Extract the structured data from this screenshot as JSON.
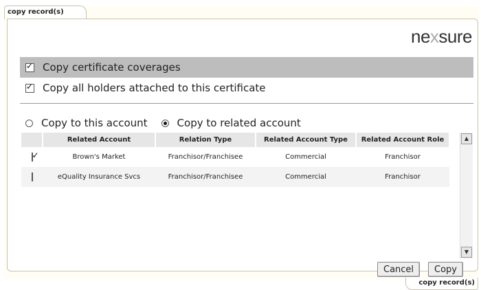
{
  "header": {
    "tab_label": "copy record(s)",
    "logo_left": "ne",
    "logo_x": "x",
    "logo_right": "sure"
  },
  "options": [
    {
      "label": "Copy certificate coverages",
      "checked": true
    },
    {
      "label": "Copy all holders attached to this certificate",
      "checked": true
    }
  ],
  "radio": {
    "this_account": "Copy to this account",
    "related_account": "Copy to related account",
    "selected": "related_account"
  },
  "table": {
    "columns": [
      "Related Account",
      "Relation Type",
      "Related Account Type",
      "Related Account Role"
    ],
    "rows": [
      {
        "checked": true,
        "cells": [
          "Brown's Market",
          "Franchisor/Franchisee",
          "Commercial",
          "Franchisor"
        ]
      },
      {
        "checked": false,
        "cells": [
          "eQuality Insurance Svcs",
          "Franchisor/Franchisee",
          "Commercial",
          "Franchisor"
        ]
      }
    ]
  },
  "buttons": {
    "cancel": "Cancel",
    "copy": "Copy"
  },
  "footer": {
    "tab_label": "copy record(s)"
  }
}
